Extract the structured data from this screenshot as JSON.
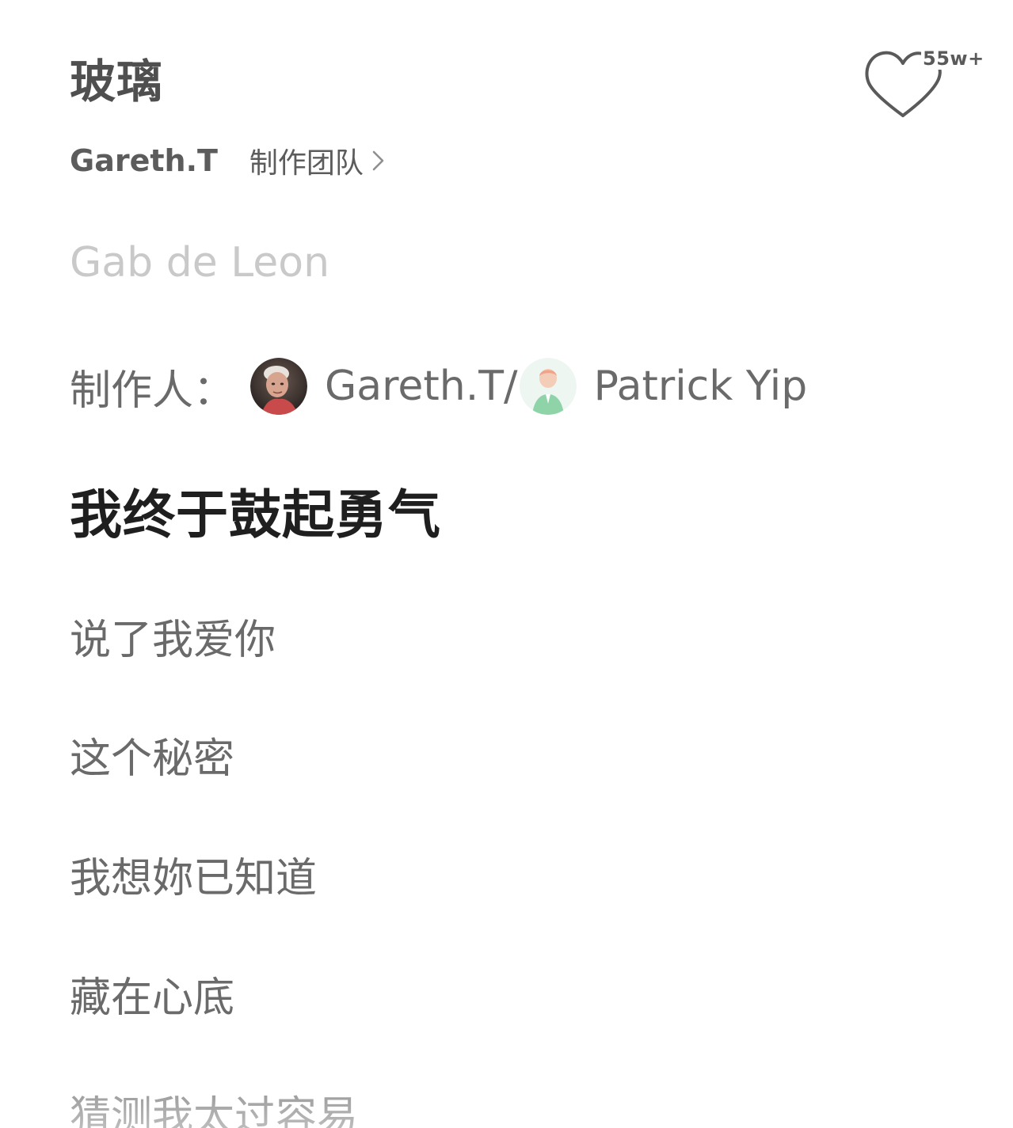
{
  "song": {
    "title": "玻璃",
    "artist": "Gareth.T",
    "team_link_label": "制作团队"
  },
  "like": {
    "count": "55w+"
  },
  "producers": {
    "label": "制作人：",
    "names": [
      "Gareth.T/",
      "Patrick Yip"
    ]
  },
  "lyrics": {
    "lines": [
      {
        "text": "Gab de Leon",
        "state": "faded"
      },
      {
        "text": "我终于鼓起勇气",
        "state": "active"
      },
      {
        "text": "说了我爱你",
        "state": "normal"
      },
      {
        "text": "这个秘密",
        "state": "normal"
      },
      {
        "text": "我想妳已知道",
        "state": "normal"
      },
      {
        "text": "藏在心底",
        "state": "normal"
      },
      {
        "text": "猜测我太过容易",
        "state": "normal"
      }
    ]
  },
  "colors": {
    "background": "#ffffff",
    "active_lyric": "#1f1f1f",
    "normal_lyric": "#6a6a6a",
    "faded_lyric": "#c9c9c9",
    "avatar_accent": "#8fd3a9"
  },
  "icons": {
    "like": "heart-icon",
    "team": "chevron-right-icon",
    "producer_2_avatar": "person-icon"
  }
}
